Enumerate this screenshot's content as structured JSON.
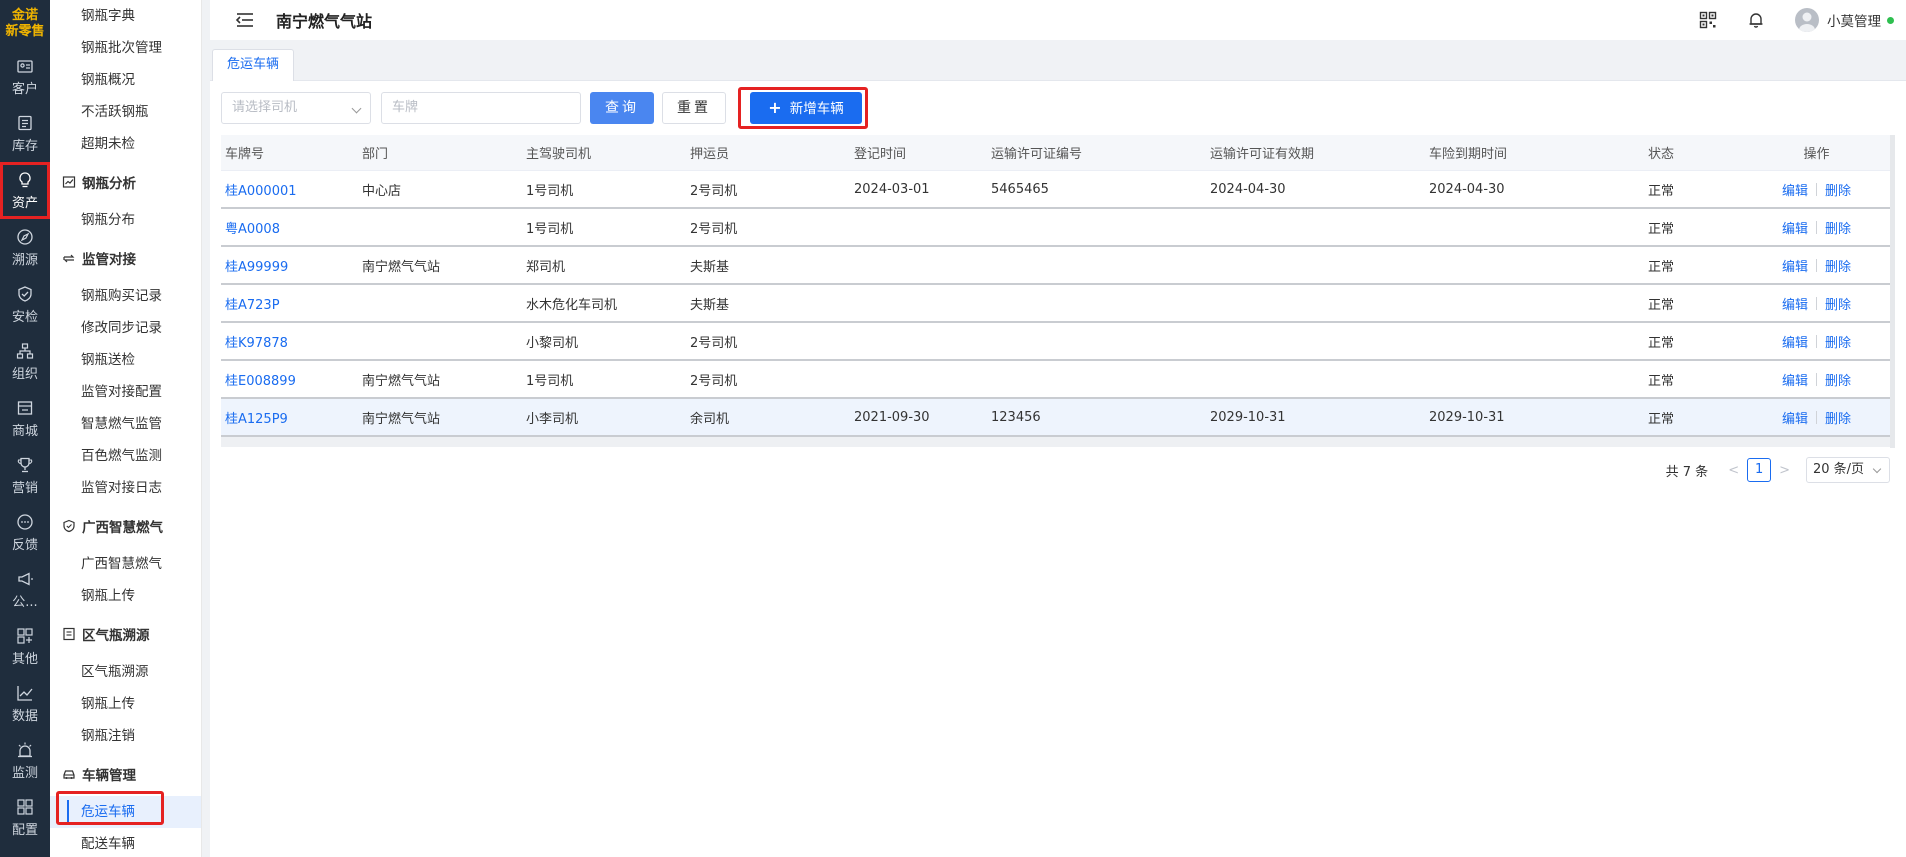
{
  "logo": {
    "line1": "金诺",
    "line2": "新零售"
  },
  "rail": [
    {
      "icon": "id-card-icon",
      "label": "客户"
    },
    {
      "icon": "list-doc-icon",
      "label": "库存"
    },
    {
      "icon": "lightbulb-icon",
      "label": "资产"
    },
    {
      "icon": "compass-icon",
      "label": "溯源"
    },
    {
      "icon": "shield-check-icon",
      "label": "安检"
    },
    {
      "icon": "org-chart-icon",
      "label": "组织"
    },
    {
      "icon": "store-icon",
      "label": "商城"
    },
    {
      "icon": "trophy-icon",
      "label": "营销"
    },
    {
      "icon": "chat-bubble-icon",
      "label": "反馈"
    },
    {
      "icon": "megaphone-icon",
      "label": "公..."
    },
    {
      "icon": "grid-plus-icon",
      "label": "其他"
    },
    {
      "icon": "line-chart-icon",
      "label": "数据"
    },
    {
      "icon": "alarm-icon",
      "label": "监测"
    },
    {
      "icon": "apps-icon",
      "label": "配置"
    }
  ],
  "submenu": {
    "top_items": [
      "钢瓶字典",
      "钢瓶批次管理",
      "钢瓶概况",
      "不活跃钢瓶",
      "超期未检"
    ],
    "groups": [
      {
        "title": "钢瓶分析",
        "icon": "analysis-icon",
        "items": [
          "钢瓶分布"
        ]
      },
      {
        "title": "监管对接",
        "icon": "sync-icon",
        "items": [
          "钢瓶购买记录",
          "修改同步记录",
          "钢瓶送检",
          "监管对接配置",
          "智慧燃气监管",
          "百色燃气监测",
          "监管对接日志"
        ]
      },
      {
        "title": "广西智慧燃气",
        "icon": "shield-icon",
        "items": [
          "广西智慧燃气",
          "钢瓶上传"
        ]
      },
      {
        "title": "区气瓶溯源",
        "icon": "document-icon",
        "items": [
          "区气瓶溯源",
          "钢瓶上传",
          "钢瓶注销"
        ]
      },
      {
        "title": "车辆管理",
        "icon": "car-icon",
        "items": [
          "危运车辆",
          "配送车辆"
        ]
      }
    ]
  },
  "header": {
    "title": "南宁燃气气站",
    "user": "小莫管理"
  },
  "tab": {
    "label": "危运车辆"
  },
  "filters": {
    "driver_placeholder": "请选择司机",
    "plate_placeholder": "车牌",
    "query_label": "查询",
    "reset_label": "重置",
    "add_label": "新增车辆"
  },
  "table": {
    "columns": [
      "车牌号",
      "部门",
      "主驾驶司机",
      "押运员",
      "登记时间",
      "运输许可证编号",
      "运输许可证有效期",
      "车险到期时间",
      "状态",
      "操作"
    ],
    "rows": [
      [
        "桂A000001",
        "中心店",
        "1号司机",
        "2号司机",
        "2024-03-01",
        "5465465",
        "2024-04-30",
        "2024-04-30",
        "正常"
      ],
      [
        "粤A0008",
        "",
        "1号司机",
        "2号司机",
        "",
        "",
        "",
        "",
        "正常"
      ],
      [
        "桂A99999",
        "南宁燃气气站",
        "郑司机",
        "夫斯基",
        "",
        "",
        "",
        "",
        "正常"
      ],
      [
        "桂A723P",
        "",
        "水木危化车司机",
        "夫斯基",
        "",
        "",
        "",
        "",
        "正常"
      ],
      [
        "桂K97878",
        "",
        "小黎司机",
        "2号司机",
        "",
        "",
        "",
        "",
        "正常"
      ],
      [
        "桂E008899",
        "南宁燃气气站",
        "1号司机",
        "2号司机",
        "",
        "",
        "",
        "",
        "正常"
      ],
      [
        "桂A125P9",
        "南宁燃气气站",
        "小李司机",
        "余司机",
        "2021-09-30",
        "123456",
        "2029-10-31",
        "2029-10-31",
        "正常"
      ]
    ],
    "edit_label": "编辑",
    "delete_label": "删除"
  },
  "pagination": {
    "total": "共 7 条",
    "current": "1",
    "page_size": "20 条/页"
  },
  "colors": {
    "accent": "#1a6cf0",
    "rail_bg": "#1f2d3d",
    "highlight_box": "#e52222"
  }
}
